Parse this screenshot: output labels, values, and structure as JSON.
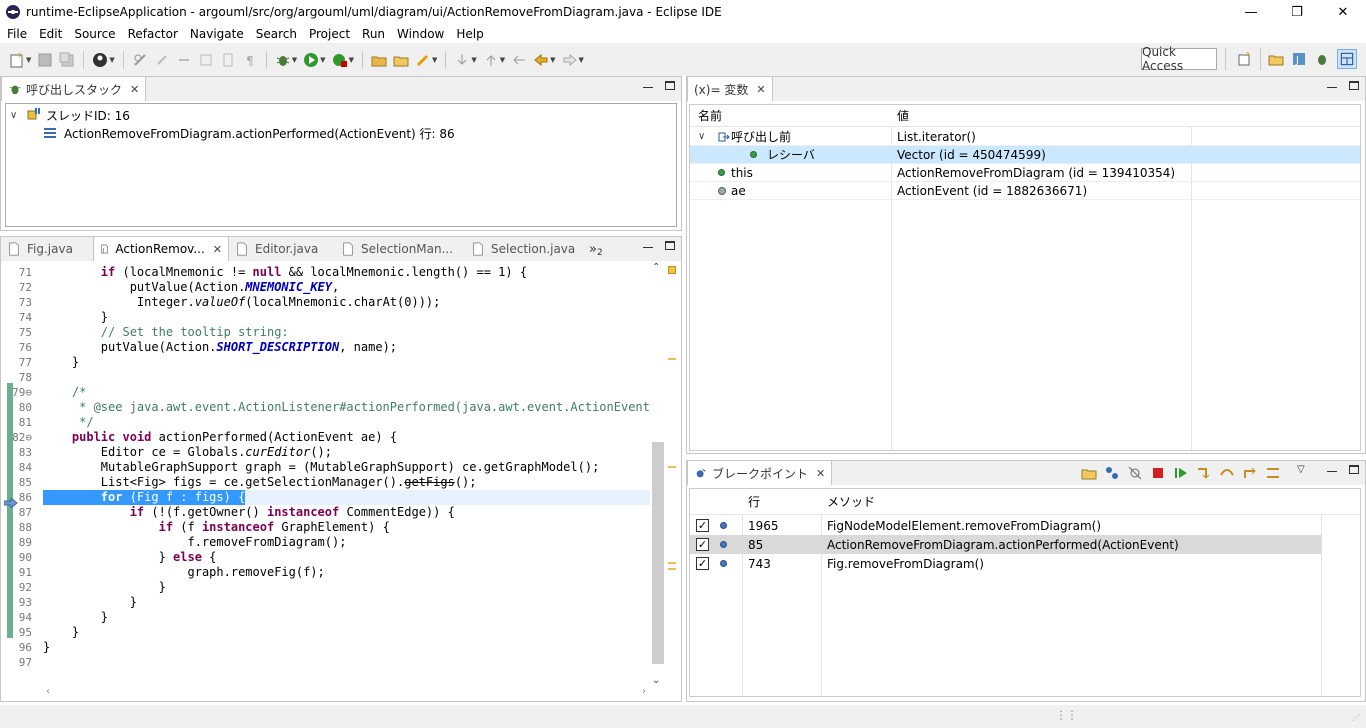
{
  "window": {
    "title": "runtime-EclipseApplication - argouml/src/org/argouml/uml/diagram/ui/ActionRemoveFromDiagram.java - Eclipse IDE",
    "minimize": "—",
    "restore": "❐",
    "close": "✕"
  },
  "menu": [
    "File",
    "Edit",
    "Source",
    "Refactor",
    "Navigate",
    "Search",
    "Project",
    "Run",
    "Window",
    "Help"
  ],
  "toolbar": {
    "quick_access": "Quick Access"
  },
  "callstack": {
    "tab_label": "呼び出しスタック",
    "thread_label": "スレッドID: 16",
    "frame_label": "ActionRemoveFromDiagram.actionPerformed(ActionEvent) 行: 86"
  },
  "editor": {
    "tabs": [
      "Fig.java",
      "ActionRemov...",
      "Editor.java",
      "SelectionMan...",
      "Selection.java"
    ],
    "overflow_label": "»",
    "overflow_count": "2",
    "lines": [
      {
        "n": "71",
        "html": "        <span class='kw'>if</span> (localMnemonic != <span class='kw'>null</span> &amp;&amp; localMnemonic.length() == 1) {"
      },
      {
        "n": "72",
        "html": "            putValue(Action.<span class='cn'>MNEMONIC_KEY</span>,"
      },
      {
        "n": "73",
        "html": "             Integer.<span class='it'>valueOf</span>(localMnemonic.charAt(0)));"
      },
      {
        "n": "74",
        "html": "        }"
      },
      {
        "n": "75",
        "html": "        <span class='cm'>// Set the tooltip string:</span>"
      },
      {
        "n": "76",
        "html": "        putValue(Action.<span class='cn'>SHORT_DESCRIPTION</span>, name);"
      },
      {
        "n": "77",
        "html": "    }"
      },
      {
        "n": "78",
        "html": ""
      },
      {
        "n": "79⊖",
        "html": "    <span class='cm'>/*</span>"
      },
      {
        "n": "80",
        "html": "     <span class='cm'>* @see java.awt.event.ActionListener#actionPerformed(java.awt.event.ActionEvent)</span>"
      },
      {
        "n": "81",
        "html": "     <span class='cm'>*/</span>"
      },
      {
        "n": "82⊖",
        "html": "    <span class='kw'>public</span> <span class='kw'>void</span> actionPerformed(ActionEvent ae) {"
      },
      {
        "n": "83",
        "html": "        Editor ce = Globals.<span class='it'>curEditor</span>();"
      },
      {
        "n": "84",
        "html": "        MutableGraphSupport graph = (MutableGraphSupport) ce.getGraphModel();"
      },
      {
        "n": "85",
        "html": "        List&lt;Fig&gt; figs = ce.getSelectionManager().<span style='text-decoration:line-through'>getFigs</span>();"
      },
      {
        "n": "86",
        "html": "        <span class='kw'>for</span> (Fig f : figs) {",
        "highlight": true
      },
      {
        "n": "87",
        "html": "            <span class='kw'>if</span> (!(f.getOwner() <span class='kw'>instanceof</span> CommentEdge)) {"
      },
      {
        "n": "88",
        "html": "                <span class='kw'>if</span> (f <span class='kw'>instanceof</span> GraphElement) {"
      },
      {
        "n": "89",
        "html": "                    f.removeFromDiagram();"
      },
      {
        "n": "90",
        "html": "                } <span class='kw'>else</span> {"
      },
      {
        "n": "91",
        "html": "                    graph.removeFig(f);"
      },
      {
        "n": "92",
        "html": "                }"
      },
      {
        "n": "93",
        "html": "            }"
      },
      {
        "n": "94",
        "html": "        }"
      },
      {
        "n": "95",
        "html": "    }"
      },
      {
        "n": "96",
        "html": "}"
      },
      {
        "n": "97",
        "html": ""
      }
    ]
  },
  "variables": {
    "tab_label": "(x)= 変数",
    "col_name": "名前",
    "col_value": "値",
    "rows": [
      {
        "name": "呼び出し前",
        "value": "List.iterator()",
        "indent": 0,
        "kind": "return",
        "expanded": true
      },
      {
        "name": "レシーバ",
        "value": "Vector  (id = 450474599)",
        "indent": 1,
        "kind": "green",
        "selected": true
      },
      {
        "name": "this",
        "value": "ActionRemoveFromDiagram  (id = 139410354)",
        "indent": 0,
        "kind": "green"
      },
      {
        "name": "ae",
        "value": "ActionEvent  (id = 1882636671)",
        "indent": 0,
        "kind": "gray"
      }
    ]
  },
  "breakpoints": {
    "tab_label": "ブレークポイント",
    "col_line": "行",
    "col_method": "メソッド",
    "rows": [
      {
        "line": "1965",
        "method": "FigNodeModelElement.removeFromDiagram()"
      },
      {
        "line": "85",
        "method": "ActionRemoveFromDiagram.actionPerformed(ActionEvent)",
        "selected": true
      },
      {
        "line": "743",
        "method": "Fig.removeFromDiagram()"
      }
    ],
    "check_mark": "✓"
  },
  "colors": {
    "selection": "#3399ff",
    "row_selected": "#cce8ff",
    "bp_selected": "#d9d9d9"
  }
}
